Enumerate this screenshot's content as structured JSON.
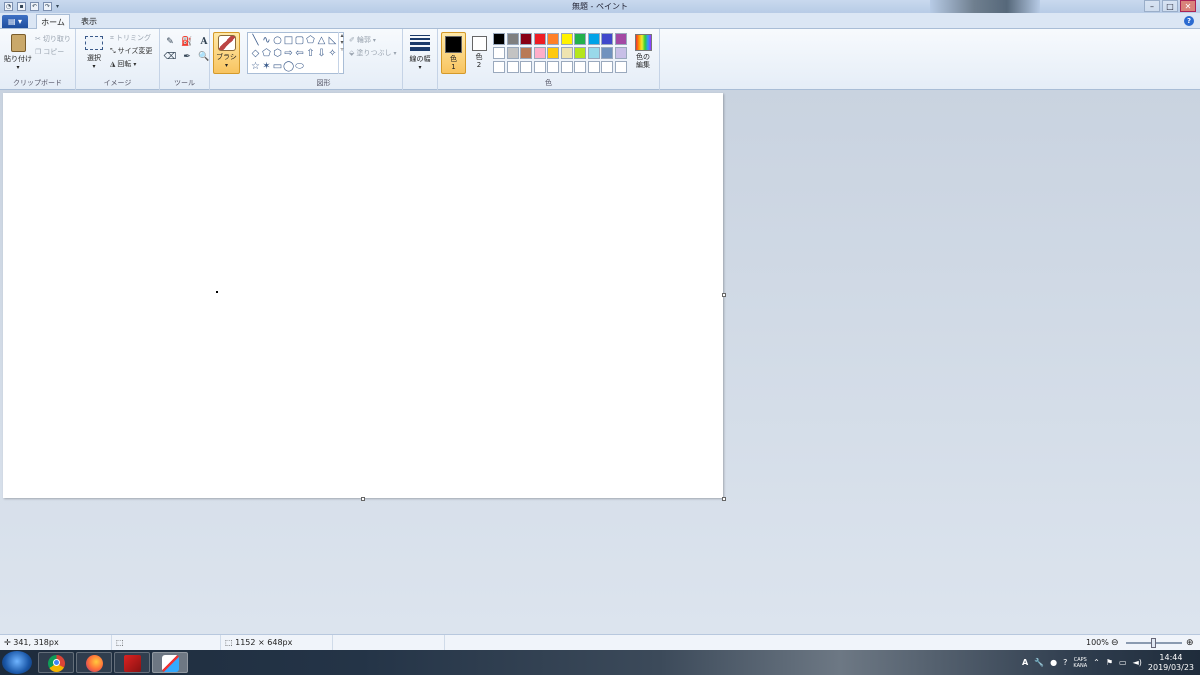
{
  "window": {
    "title": "無題 - ペイント",
    "controls": [
      "–",
      "□",
      "✕"
    ]
  },
  "tabs": {
    "file_label": "▤ ▾",
    "items": [
      "ホーム",
      "表示"
    ],
    "active": "ホーム"
  },
  "ribbon": {
    "clipboard": {
      "paste": "貼り付け",
      "cut": "切り取り",
      "copy": "コピー",
      "label": "クリップボード"
    },
    "image": {
      "select": "選択",
      "crop": "トリミング",
      "resize": "サイズ変更",
      "rotate": "回転",
      "label": "イメージ"
    },
    "tools": {
      "label": "ツール",
      "items": [
        "✎",
        "⛽",
        "A",
        "⌫",
        "✒",
        "🔍"
      ]
    },
    "brush": {
      "label": "ブラシ"
    },
    "shapes": {
      "label": "図形",
      "outline": "輪郭",
      "fill": "塗りつぶし",
      "items": [
        "╲",
        "∿",
        "○",
        "□",
        "▢",
        "⬠",
        "△",
        "◺",
        "◇",
        "⬠",
        "⬡",
        "⇨",
        "⇦",
        "⇧",
        "⇩",
        "✧",
        "☆",
        "✶",
        "▭",
        "◯",
        "⬭"
      ]
    },
    "line_width": {
      "label": "線の幅"
    },
    "colors": {
      "color1_label": "色\n1",
      "color2_label": "色\n2",
      "color1_value": "#000000",
      "color2_value": "#ffffff",
      "edit_label": "色の\n編集",
      "label": "色",
      "palette": [
        "#000000",
        "#7f7f7f",
        "#880015",
        "#ed1c24",
        "#ff7f27",
        "#fff200",
        "#22b14c",
        "#00a2e8",
        "#3f48cc",
        "#a349a4",
        "#ffffff",
        "#c3c3c3",
        "#b97a57",
        "#ffaec9",
        "#ffc90e",
        "#efe4b0",
        "#b5e61d",
        "#99d9ea",
        "#7092be",
        "#c8bfe7",
        "#ffffff",
        "#ffffff",
        "#ffffff",
        "#ffffff",
        "#ffffff",
        "#ffffff",
        "#ffffff",
        "#ffffff",
        "#ffffff",
        "#ffffff"
      ]
    }
  },
  "statusbar": {
    "cursor_pos": "341, 318px",
    "canvas_size": "1152 × 648px",
    "zoom": "100%"
  },
  "taskbar": {
    "time": "14:44",
    "date": "2019/03/23",
    "ime": "A",
    "caps": "CAPS\nKANA"
  }
}
